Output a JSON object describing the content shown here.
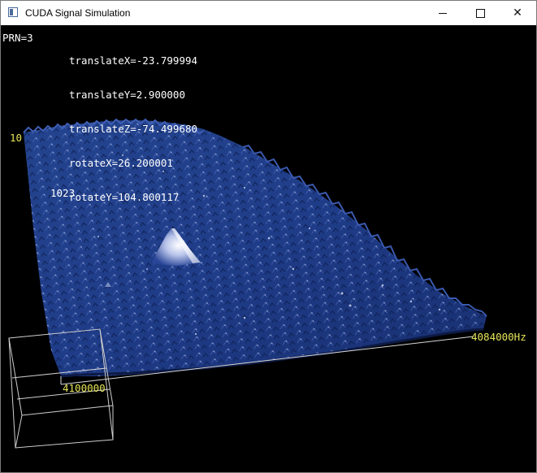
{
  "window": {
    "title": "CUDA Signal Simulation",
    "controls": {
      "minimize": "minimize-icon",
      "maximize": "maximize-icon",
      "close": "close-icon"
    }
  },
  "hud": {
    "prn": "PRN=3",
    "params": [
      "translateX=-23.799994",
      "translateY=2.900000",
      "translateZ=-74.499680",
      "rotateX=26.200001",
      "rotateY=104.800117"
    ]
  },
  "axis_labels": {
    "corner_top_left": "10",
    "code_max": "1023",
    "freq_right": "4084000Hz",
    "freq_bottom": "4100000"
  },
  "colors": {
    "surface": "#1e3a8a",
    "surface_highlight": "#c8d2f0",
    "axis_label": "#e6e65a",
    "axis_line": "#d8d8d8"
  }
}
